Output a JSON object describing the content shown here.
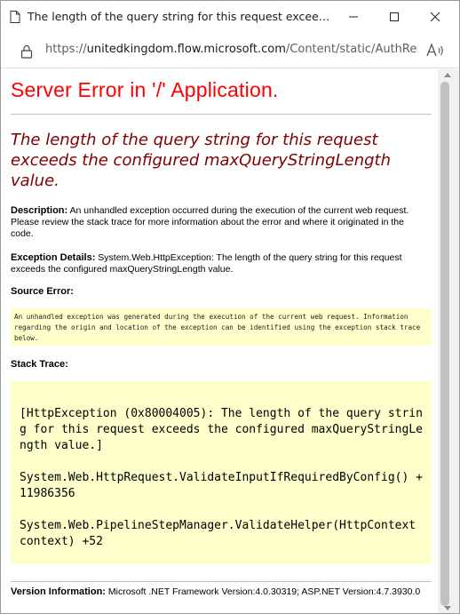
{
  "window": {
    "title": "The length of the query string for this request exceeds the conf..."
  },
  "address_bar": {
    "url_prefix": "https://",
    "url_host": "unitedkingdom.flow.microsoft.com",
    "url_path": "/Content/static/AuthRe...",
    "read_aloud": "A̩"
  },
  "page": {
    "heading": "Server Error in '/' Application.",
    "message": "The length of the query string for this request exceeds the configured maxQueryStringLength value.",
    "description_label": "Description:",
    "description_text": " An unhandled exception occurred during the execution of the current web request. Please review the stack trace for more information about the error and where it originated in the code.",
    "exception_label": "Exception Details:",
    "exception_text": " System.Web.HttpException: The length of the query string for this request exceeds the configured maxQueryStringLength value.",
    "source_error_label": "Source Error:",
    "source_error_text": "An unhandled exception was generated during the execution of the current web request. Information regarding the origin and location of the exception can be identified using the exception stack trace below.",
    "stack_trace_label": "Stack Trace:",
    "stack_lines": [
      "[HttpException (0x80004005): The length of the query string for this request exceeds the configured maxQueryStringLength value.]",
      "System.Web.HttpRequest.ValidateInputIfRequiredByConfig() +11986356",
      "System.Web.PipelineStepManager.ValidateHelper(HttpContext context) +52"
    ],
    "version_label": "Version Information:",
    "version_text": " Microsoft .NET Framework Version:4.0.30319; ASP.NET Version:4.7.3930.0"
  },
  "colors": {
    "heading": "#ff0000",
    "message": "#800000",
    "code_background": "#ffffcc"
  }
}
